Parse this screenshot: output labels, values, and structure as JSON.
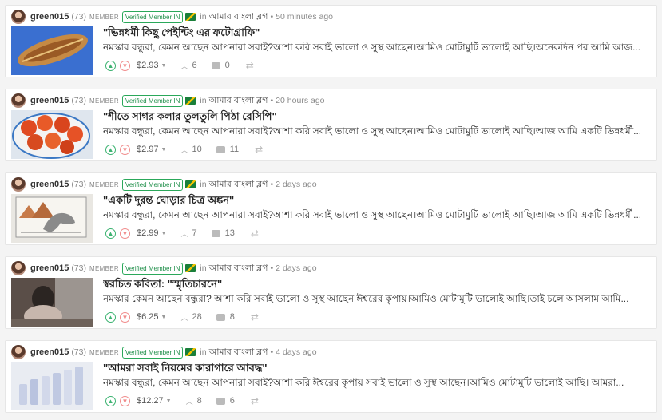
{
  "posts": [
    {
      "author": "green015",
      "reputation": "(73)",
      "member_label": "MEMBER",
      "verified_label": "Verified Member IN",
      "in_label": "in",
      "community": "আমার বাংলা ব্লগ",
      "time": "50 minutes ago",
      "title": "\"ভিন্নধর্মী কিছু পেইন্টিং এর ফটোগ্রাফি\"",
      "excerpt": "নমস্কার বন্ধুরা, কেমন আছেন আপনারা সবাই?আশা করি সবাই ভালো ও সুস্থ আছেন।আমিও মোটামুটি ভালোই আছি।অনেকদিন পর আমি আজ...",
      "payout": "$2.93",
      "votes": "6",
      "comments": "0"
    },
    {
      "author": "green015",
      "reputation": "(73)",
      "member_label": "MEMBER",
      "verified_label": "Verified Member IN",
      "in_label": "in",
      "community": "আমার বাংলা ব্লগ",
      "time": "20 hours ago",
      "title": "\"শীতে সাগর কলার তুলতুলি পিঠা রেসিপি\"",
      "excerpt": "নমস্কার বন্ধুরা, কেমন আছেন আপনারা সবাই?আশা করি সবাই ভালো ও সুস্থ আছেন।আমিও মোটামুটি ভালোই আছি।আজ আমি একটি ভিন্নধর্মী...",
      "payout": "$2.97",
      "votes": "10",
      "comments": "11"
    },
    {
      "author": "green015",
      "reputation": "(73)",
      "member_label": "MEMBER",
      "verified_label": "Verified Member IN",
      "in_label": "in",
      "community": "আমার বাংলা ব্লগ",
      "time": "2 days ago",
      "title": "\"একটি দুরন্ত ঘোড়ার চিত্র অঙ্কন\"",
      "excerpt": "নমস্কার বন্ধুরা, কেমন আছেন আপনারা সবাই?আশা করি সবাই ভালো ও সুস্থ আছেন।আমিও মোটামুটি ভালোই আছি।আজ আমি একটি ভিন্নধর্মী...",
      "payout": "$2.99",
      "votes": "7",
      "comments": "13"
    },
    {
      "author": "green015",
      "reputation": "(73)",
      "member_label": "MEMBER",
      "verified_label": "Verified Member IN",
      "in_label": "in",
      "community": "আমার বাংলা ব্লগ",
      "time": "2 days ago",
      "title": "স্বরচিত কবিতা: \"স্মৃতিচারনে\"",
      "excerpt": "নমস্কার কেমন আছেন বন্ধুরা? আশা করি সবাই ভালো ও সুস্থ আছেন ঈশ্বরের কৃপায়।আমিও মোটামুটি ভালোই আছি।তাই চলে আসলাম আমি...",
      "payout": "$6.25",
      "votes": "28",
      "comments": "8"
    },
    {
      "author": "green015",
      "reputation": "(73)",
      "member_label": "MEMBER",
      "verified_label": "Verified Member IN",
      "in_label": "in",
      "community": "আমার বাংলা ব্লগ",
      "time": "4 days ago",
      "title": "\"আমরা সবাই নিয়মের কারাগারে আবদ্ধ\"",
      "excerpt": "নমস্কার বন্ধুরা, কেমন আছেন আপনারা সবাই?আশা করি ঈশ্বরের কৃপায় সবাই ভালো ও সুস্থ আছেন।আমিও মোটামুটি ভালোই আছি। আমরা...",
      "payout": "$12.27",
      "votes": "8",
      "comments": "6"
    }
  ]
}
